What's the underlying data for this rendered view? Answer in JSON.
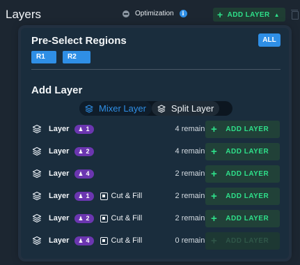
{
  "header": {
    "title": "Layers",
    "optimization_label": "Optimization",
    "info_symbol": "i",
    "add_layer_label": "ADD LAYER",
    "plus": "+",
    "caret": "▲"
  },
  "preselect": {
    "title": "Pre-Select Regions",
    "all_label": "ALL",
    "regions": [
      "R1",
      "R2"
    ]
  },
  "add_layer": {
    "title": "Add Layer",
    "toggle": {
      "active": "Mixer Layer",
      "inactive": "Split Layer"
    },
    "rows": [
      {
        "label": "Layer",
        "badge": "1",
        "cut_fill": "",
        "remaining": "4 remaining",
        "button": "ADD LAYER",
        "enabled": true
      },
      {
        "label": "Layer",
        "badge": "2",
        "cut_fill": "",
        "remaining": "4 remaining",
        "button": "ADD LAYER",
        "enabled": true
      },
      {
        "label": "Layer",
        "badge": "4",
        "cut_fill": "",
        "remaining": "2 remaining",
        "button": "ADD LAYER",
        "enabled": true
      },
      {
        "label": "Layer",
        "badge": "1",
        "cut_fill": "Cut & Fill",
        "remaining": "2 remaining",
        "button": "ADD LAYER",
        "enabled": true
      },
      {
        "label": "Layer",
        "badge": "2",
        "cut_fill": "Cut & Fill",
        "remaining": "2 remaining",
        "button": "ADD LAYER",
        "enabled": true
      },
      {
        "label": "Layer",
        "badge": "4",
        "cut_fill": "Cut & Fill",
        "remaining": "0 remaining",
        "button": "ADD LAYER",
        "enabled": false
      }
    ]
  },
  "icons": {
    "person": "♟"
  },
  "colors": {
    "accent_blue": "#2f8fe6",
    "accent_green": "#2ee08a",
    "badge_purple": "#6b36b0",
    "background": "#1c2631",
    "panel": "#1a2d3d"
  }
}
